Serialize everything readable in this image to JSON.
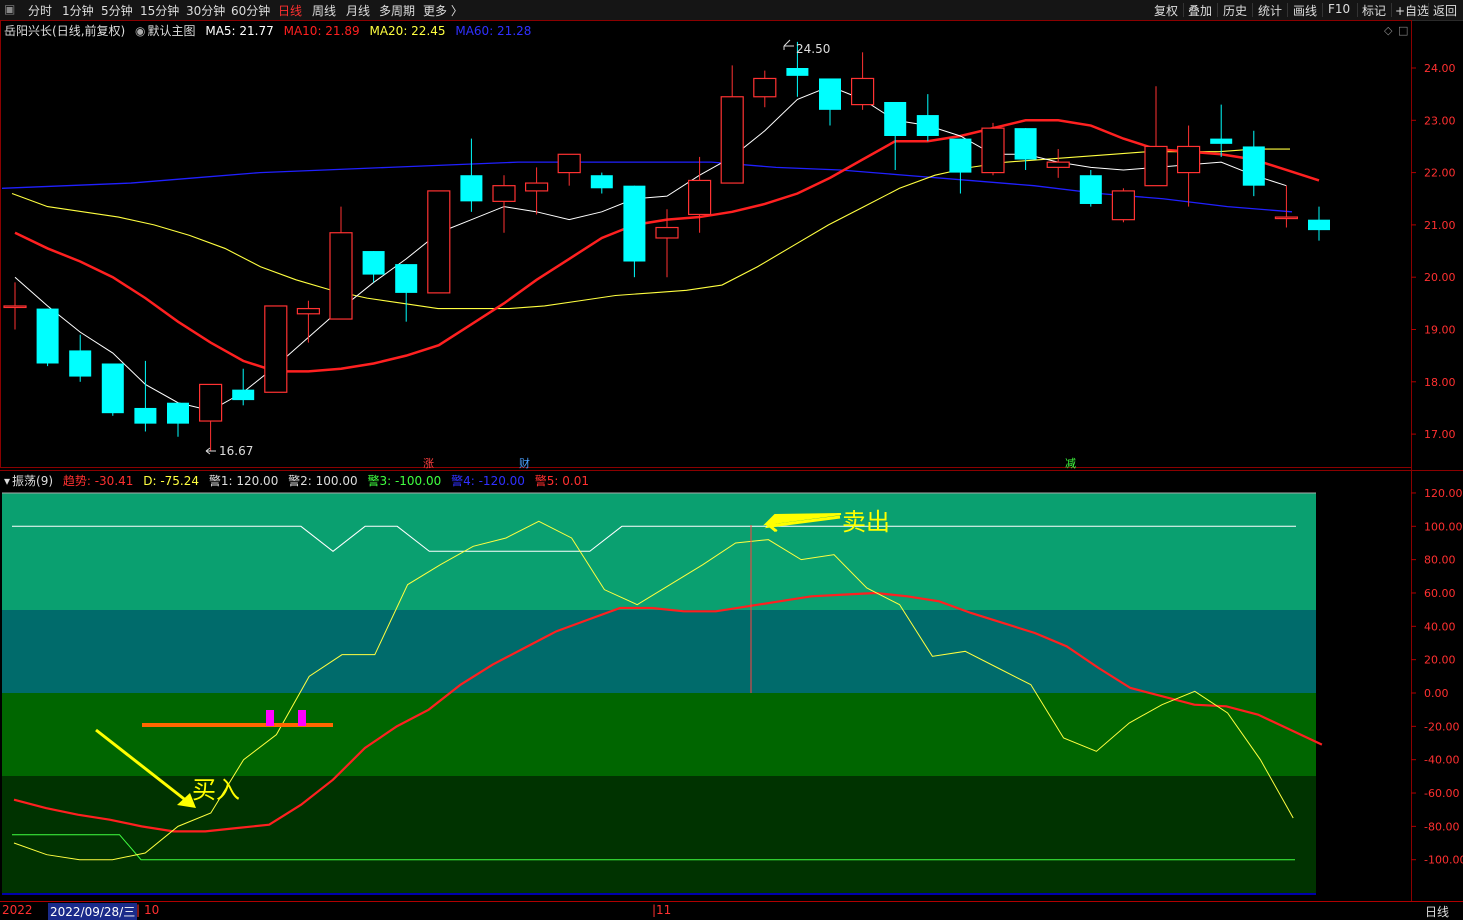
{
  "toolbar": {
    "left_tabs": [
      "分时",
      "1分钟",
      "5分钟",
      "15分钟",
      "30分钟",
      "60分钟",
      "日线",
      "周线",
      "月线",
      "多周期",
      "更多 〉"
    ],
    "active_tab": "日线",
    "right_buttons": [
      "复权",
      "叠加",
      "历史",
      "统计",
      "画线",
      "F10",
      "标记",
      "+自选",
      "返回"
    ]
  },
  "main_panel": {
    "stock": "岳阳兴长",
    "mode": "(日线,前复权)",
    "template": "默认主图",
    "ma5": "MA5: 21.77",
    "ma10": "MA10: 21.89",
    "ma20": "MA20: 22.45",
    "ma60": "MA60: 21.28",
    "high_label": "24.50",
    "low_label": "16.67",
    "markers": [
      "涨",
      "财",
      "减"
    ],
    "corner_icons": [
      "diamond-icon",
      "square-icon"
    ]
  },
  "osc_panel": {
    "name": "振荡(9)",
    "trend": "趋势: -30.41",
    "d": "D: -75.24",
    "w1": "警1: 120.00",
    "w2": "警2: 100.00",
    "w3": "警3: -100.00",
    "w4": "警4: -120.00",
    "w5": "警5: 0.01",
    "sell_label": "卖出",
    "buy_label": "买入"
  },
  "bottom": {
    "year": "2022",
    "date": "2022/09/28/三",
    "m10": "10",
    "m11": "11",
    "period": "日线"
  },
  "colors": {
    "up": "#ff3232",
    "down": "#00ffff",
    "ma5": "#ffffff",
    "ma10": "#ff2020",
    "ma20": "#ffff40",
    "ma60": "#2020ff",
    "band_top": "#0aa070",
    "band_mid": "#006b6b",
    "band_low": "#006600",
    "band_bottom": "#003300"
  },
  "chart_data": [
    {
      "type": "candlestick",
      "title": "岳阳兴长 (日线,前复权)",
      "y_ticks": [
        24.0,
        23.0,
        22.0,
        21.0,
        20.0,
        19.0,
        18.0,
        17.0
      ],
      "ylim": [
        16.6,
        24.95
      ],
      "candles": [
        {
          "o": 19.45,
          "c": 19.45,
          "h": 19.9,
          "l": 19.0
        },
        {
          "o": 19.4,
          "c": 18.35,
          "h": 19.4,
          "l": 18.3
        },
        {
          "o": 18.6,
          "c": 18.1,
          "h": 18.9,
          "l": 18.0
        },
        {
          "o": 18.35,
          "c": 17.4,
          "h": 18.35,
          "l": 17.35
        },
        {
          "o": 17.5,
          "c": 17.2,
          "h": 18.4,
          "l": 17.05
        },
        {
          "o": 17.6,
          "c": 17.2,
          "h": 17.6,
          "l": 16.95
        },
        {
          "o": 17.25,
          "c": 17.95,
          "h": 17.95,
          "l": 16.67
        },
        {
          "o": 17.85,
          "c": 17.65,
          "h": 18.25,
          "l": 17.55
        },
        {
          "o": 17.8,
          "c": 19.45,
          "h": 19.45,
          "l": 17.8
        },
        {
          "o": 19.3,
          "c": 19.4,
          "h": 19.55,
          "l": 18.75
        },
        {
          "o": 19.2,
          "c": 20.85,
          "h": 21.35,
          "l": 19.2
        },
        {
          "o": 20.5,
          "c": 20.05,
          "h": 20.5,
          "l": 19.9
        },
        {
          "o": 20.25,
          "c": 19.7,
          "h": 20.25,
          "l": 19.15
        },
        {
          "o": 19.7,
          "c": 21.65,
          "h": 21.65,
          "l": 19.7
        },
        {
          "o": 21.95,
          "c": 21.45,
          "h": 22.65,
          "l": 21.25
        },
        {
          "o": 21.45,
          "c": 21.75,
          "h": 21.95,
          "l": 20.85
        },
        {
          "o": 21.65,
          "c": 21.8,
          "h": 22.1,
          "l": 21.2
        },
        {
          "o": 22.0,
          "c": 22.35,
          "h": 22.35,
          "l": 21.75
        },
        {
          "o": 21.95,
          "c": 21.7,
          "h": 22.0,
          "l": 21.6
        },
        {
          "o": 21.75,
          "c": 20.3,
          "h": 21.75,
          "l": 20.0
        },
        {
          "o": 20.75,
          "c": 20.95,
          "h": 21.3,
          "l": 20.0
        },
        {
          "o": 21.2,
          "c": 21.85,
          "h": 22.3,
          "l": 20.85
        },
        {
          "o": 21.8,
          "c": 23.45,
          "h": 24.05,
          "l": 21.8
        },
        {
          "o": 23.45,
          "c": 23.8,
          "h": 23.95,
          "l": 23.25
        },
        {
          "o": 24.0,
          "c": 23.85,
          "h": 24.5,
          "l": 23.45
        },
        {
          "o": 23.8,
          "c": 23.2,
          "h": 23.8,
          "l": 22.9
        },
        {
          "o": 23.3,
          "c": 23.8,
          "h": 24.3,
          "l": 23.2
        },
        {
          "o": 23.35,
          "c": 22.7,
          "h": 23.35,
          "l": 22.05
        },
        {
          "o": 23.1,
          "c": 22.7,
          "h": 23.5,
          "l": 22.6
        },
        {
          "o": 22.65,
          "c": 22.0,
          "h": 22.65,
          "l": 21.6
        },
        {
          "o": 22.0,
          "c": 22.85,
          "h": 22.95,
          "l": 21.95
        },
        {
          "o": 22.85,
          "c": 22.25,
          "h": 22.85,
          "l": 22.05
        },
        {
          "o": 22.1,
          "c": 22.2,
          "h": 22.45,
          "l": 21.9
        },
        {
          "o": 21.95,
          "c": 21.4,
          "h": 22.05,
          "l": 21.35
        },
        {
          "o": 21.1,
          "c": 21.65,
          "h": 21.7,
          "l": 21.05
        },
        {
          "o": 21.75,
          "c": 22.5,
          "h": 23.65,
          "l": 21.75
        },
        {
          "o": 22.0,
          "c": 22.5,
          "h": 22.9,
          "l": 21.35
        },
        {
          "o": 22.65,
          "c": 22.55,
          "h": 23.3,
          "l": 22.3
        },
        {
          "o": 22.5,
          "c": 21.75,
          "h": 22.8,
          "l": 21.55
        },
        {
          "o": 21.15,
          "c": 21.15,
          "h": 21.75,
          "l": 20.95
        },
        {
          "o": 21.1,
          "c": 20.9,
          "h": 21.35,
          "l": 20.7
        }
      ],
      "ma5": [
        20.0,
        19.45,
        18.95,
        18.55,
        17.95,
        17.6,
        17.45,
        17.8,
        18.3,
        18.85,
        19.4,
        19.9,
        20.35,
        20.85,
        21.1,
        21.35,
        21.25,
        21.1,
        21.25,
        21.5,
        21.55,
        21.95,
        22.3,
        22.8,
        23.4,
        23.65,
        23.4,
        23.0,
        22.9,
        22.7,
        22.35,
        22.35,
        22.2,
        22.1,
        22.05,
        22.1,
        22.15,
        22.2,
        21.95,
        21.75
      ],
      "ma10": [
        20.85,
        20.55,
        20.3,
        20.0,
        19.6,
        19.15,
        18.75,
        18.4,
        18.2,
        18.2,
        18.25,
        18.35,
        18.5,
        18.7,
        19.1,
        19.5,
        19.95,
        20.35,
        20.75,
        21.0,
        21.1,
        21.15,
        21.25,
        21.4,
        21.6,
        21.9,
        22.25,
        22.6,
        22.6,
        22.7,
        22.85,
        23.0,
        23.0,
        22.9,
        22.65,
        22.45,
        22.4,
        22.35,
        22.25,
        22.05,
        21.85
      ],
      "ma20": [
        21.6,
        21.35,
        21.25,
        21.15,
        21.0,
        20.8,
        20.55,
        20.2,
        19.95,
        19.75,
        19.6,
        19.5,
        19.4,
        19.4,
        19.4,
        19.45,
        19.55,
        19.65,
        19.7,
        19.75,
        19.85,
        20.2,
        20.6,
        21.0,
        21.35,
        21.7,
        21.95,
        22.1,
        22.2,
        22.25,
        22.3,
        22.35,
        22.4,
        22.4,
        22.4,
        22.45,
        22.45
      ],
      "ma60": [
        21.7,
        21.75,
        21.8,
        21.9,
        22.0,
        22.05,
        22.1,
        22.15,
        22.2,
        22.2,
        22.2,
        22.2,
        22.1,
        22.05,
        21.95,
        21.85,
        21.75,
        21.6,
        21.5,
        21.35,
        21.25
      ]
    },
    {
      "type": "line",
      "title": "振荡(9)",
      "y_ticks": [
        120.0,
        100.0,
        80.0,
        60.0,
        40.0,
        20.0,
        0.0,
        -20.0,
        -40.0,
        -60.0,
        -80.0,
        -100.0
      ],
      "ylim": [
        -125,
        127
      ],
      "series": [
        {
          "name": "趋势",
          "values": [
            -90,
            -97,
            -100,
            -100,
            -96,
            -80,
            -72,
            -40,
            -25,
            10,
            23,
            23,
            65,
            77,
            88,
            93,
            103,
            93,
            62,
            53,
            65,
            77,
            90,
            92,
            80,
            83,
            63,
            53,
            22,
            25,
            15,
            5,
            -27,
            -35,
            -18,
            -7,
            1,
            -12,
            -40,
            -75
          ]
        },
        {
          "name": "D",
          "values": [
            -64,
            -69,
            -73,
            -76,
            -80,
            -83,
            -83,
            -81,
            -79,
            -67,
            -52,
            -33,
            -20,
            -10,
            5,
            17,
            27,
            37,
            44,
            51,
            51,
            49,
            49,
            52,
            55,
            58,
            59,
            60,
            58,
            55,
            48,
            42,
            36,
            28,
            15,
            3,
            -2,
            -7,
            -8,
            -13,
            -22,
            -31
          ]
        },
        {
          "name": "警1",
          "values": [
            120
          ]
        },
        {
          "name": "警2",
          "values": [
            100,
            100,
            100,
            100,
            100,
            100,
            100,
            100,
            100,
            100,
            85,
            100,
            100,
            85,
            85,
            85,
            85,
            85,
            85,
            100,
            100,
            100,
            100,
            100,
            100,
            100,
            100,
            100,
            100,
            100,
            100,
            100,
            100,
            100,
            100,
            100,
            100,
            100,
            100,
            100,
            100
          ]
        },
        {
          "name": "警3",
          "values": [
            -85,
            -85,
            -85,
            -85,
            -85,
            -85,
            -100,
            -100,
            -100,
            -100
          ]
        },
        {
          "name": "警4",
          "values": [
            -120
          ]
        },
        {
          "name": "警5",
          "values": [
            0.01
          ]
        }
      ]
    }
  ]
}
